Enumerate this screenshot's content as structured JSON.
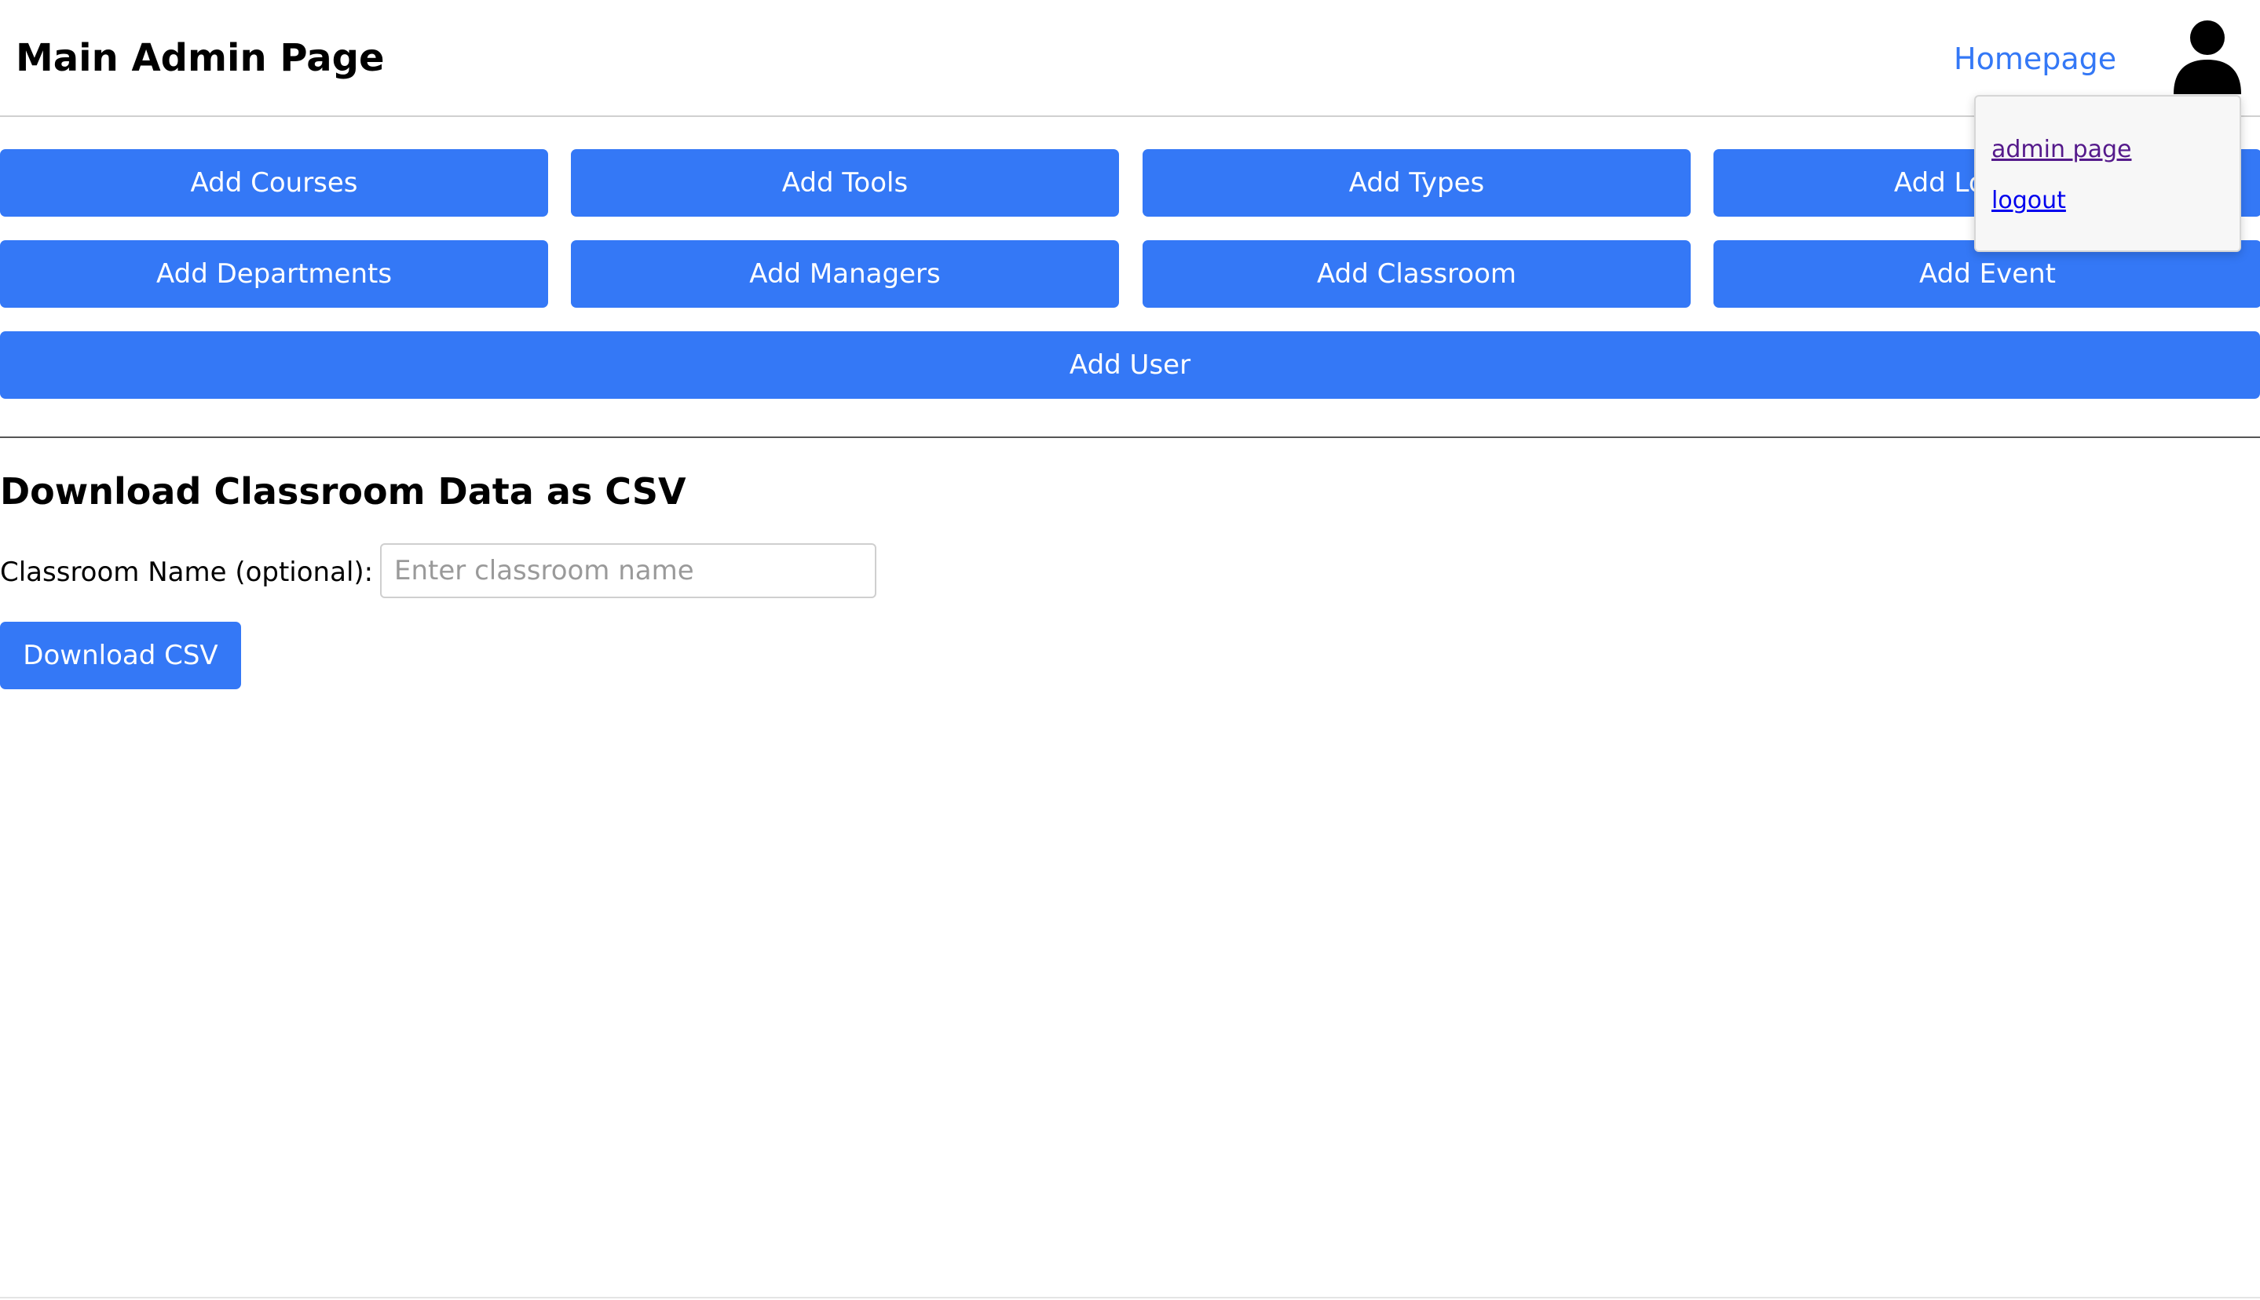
{
  "header": {
    "title": "Main Admin Page",
    "homepage_link": "Homepage",
    "avatar_icon": "user-icon"
  },
  "user_menu": {
    "items": [
      {
        "label": "admin page"
      },
      {
        "label": "logout"
      }
    ]
  },
  "actions": {
    "row1": [
      "Add Courses",
      "Add Tools",
      "Add Types",
      "Add Locations"
    ],
    "row2": [
      "Add Departments",
      "Add Managers",
      "Add Classroom",
      "Add Event"
    ],
    "full_width": "Add User"
  },
  "csv_section": {
    "title": "Download Classroom Data as CSV",
    "field_label": "Classroom Name (optional):",
    "input_placeholder": "Enter classroom name",
    "input_value": "",
    "button_label": "Download CSV"
  },
  "colors": {
    "accent": "#3478f6",
    "link_visited": "#551a8b",
    "link": "#0000ee"
  }
}
